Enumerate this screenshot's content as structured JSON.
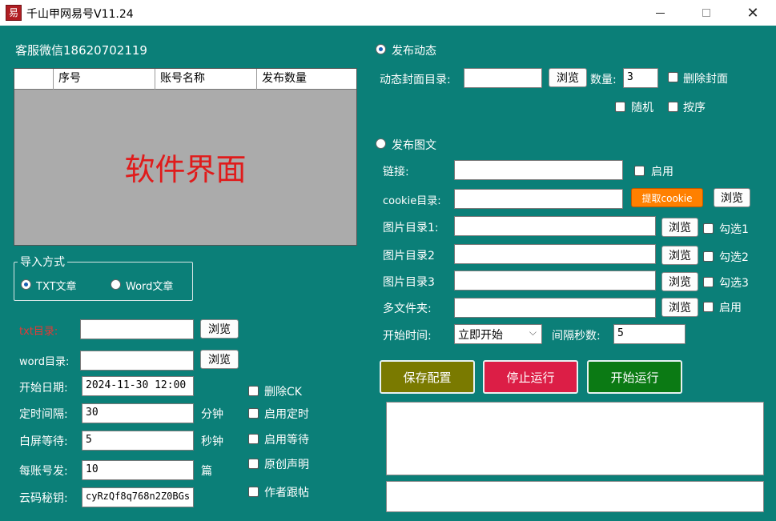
{
  "window": {
    "title": "千山甲网易号V11.24",
    "icon_glyph": "易"
  },
  "left": {
    "service": "客服微信18620702119",
    "table": {
      "columns": [
        "",
        "序号",
        "账号名称",
        "发布数量"
      ],
      "watermark": "软件界面"
    },
    "import_group": {
      "legend": "导入方式",
      "txt_label": "TXT文章",
      "word_label": "Word文章",
      "selected": "txt"
    },
    "txt_dir_label": "txt目录:",
    "word_dir_label": "word目录:",
    "browse_label": "浏览",
    "start_date_label": "开始日期:",
    "start_date_value": "2024-11-30 12:00",
    "interval_label": "定时间隔:",
    "interval_value": "30",
    "interval_unit": "分钟",
    "wait_label": "白屏等待:",
    "wait_value": "5",
    "wait_unit": "秒钟",
    "per_account_label": "每账号发:",
    "per_account_value": "10",
    "per_account_unit": "篇",
    "captcha_label": "云码秘钥:",
    "captcha_value": "cyRzQf8q768n2Z0BGs",
    "options": [
      "删除CK",
      "启用定时",
      "启用等待",
      "原创声明",
      "作者跟帖"
    ]
  },
  "right": {
    "dynamic_radio": "发布动态",
    "cover_dir_label": "动态封面目录:",
    "count_label": "数量:",
    "count_value": "3",
    "delete_cover": "删除封面",
    "random": "随机",
    "in_order": "按序",
    "article_radio": "发布图文",
    "link_label": "链接:",
    "enable": "启用",
    "cookie_label": "cookie目录:",
    "extract_cookie": "提取cookie",
    "img_dir1": "图片目录1:",
    "img_dir2": "图片目录2",
    "img_dir3": "图片目录3",
    "check1": "勾选1",
    "check2": "勾选2",
    "check3": "勾选3",
    "multi_folder": "多文件夹:",
    "start_time_label": "开始时间:",
    "start_time_value": "立即开始",
    "interval_sec_label": "间隔秒数:",
    "interval_sec_value": "5",
    "save_config": "保存配置",
    "stop_run": "停止运行",
    "start_run": "开始运行",
    "selected_mode": "dynamic"
  },
  "colors": {
    "background": "#0b7f78",
    "save_btn": "#7a7a00",
    "stop_btn": "#dc1e46",
    "start_btn": "#0b7a14",
    "extract_btn": "#ff8000"
  }
}
